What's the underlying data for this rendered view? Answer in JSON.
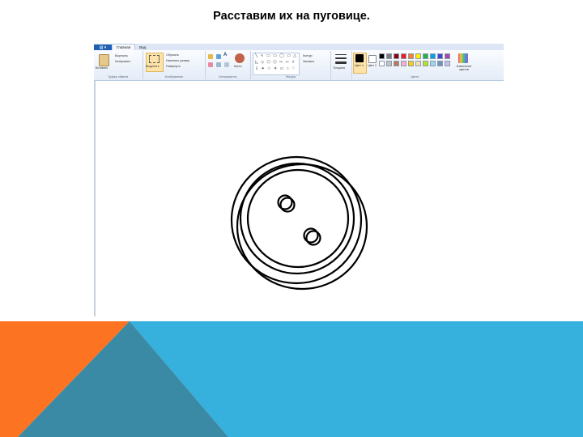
{
  "slide": {
    "title": "Расставим их на пуговице."
  },
  "paint": {
    "tabs": [
      "Главная",
      "Вид"
    ],
    "groups": [
      "Буфер обмена",
      "Изображение",
      "Инструменты",
      "Фигуры",
      "Цвета"
    ],
    "clipboard": {
      "paste": "Вставить",
      "cut": "Вырезать",
      "copy": "Копировать"
    },
    "image": {
      "select": "Выделить",
      "crop": "Обрезать",
      "resize": "Изменить размер",
      "rotate": "Повернуть"
    },
    "tools": {
      "brushes": "Кисти"
    },
    "shapes": {
      "outline": "Контур",
      "fill": "Заливка"
    },
    "size": "Толщина",
    "colors": {
      "color1": "Цвет 1",
      "color2": "Цвет 2",
      "edit": "Изменение цветов"
    },
    "palette_row1": [
      "#000000",
      "#7f7f7f",
      "#880015",
      "#ed1c24",
      "#ff7f27",
      "#fff200",
      "#22b14c",
      "#00a2e8",
      "#3f48cc",
      "#a349a4"
    ],
    "palette_row2": [
      "#ffffff",
      "#c3c3c3",
      "#b97a57",
      "#ffaec9",
      "#ffc90e",
      "#efe4b0",
      "#b5e61d",
      "#99d9ea",
      "#7092be",
      "#c8bfe7"
    ]
  },
  "colors": {
    "orange": "#fc7422",
    "blue": "#36b0dd",
    "teal": "#3a8aa6"
  }
}
